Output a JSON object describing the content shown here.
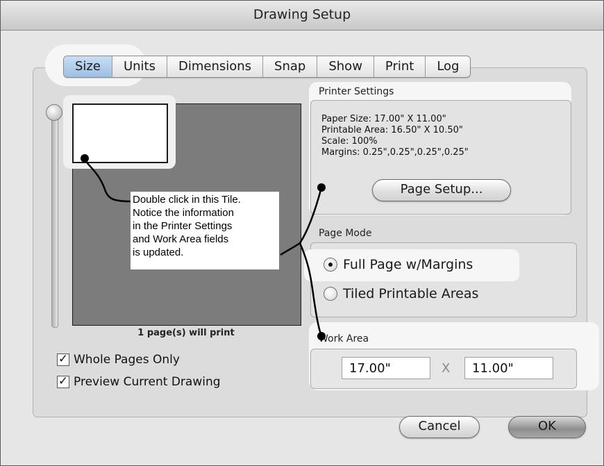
{
  "window": {
    "title": "Drawing Setup"
  },
  "tabs": [
    {
      "label": "Size",
      "active": true
    },
    {
      "label": "Units",
      "active": false
    },
    {
      "label": "Dimensions",
      "active": false
    },
    {
      "label": "Snap",
      "active": false
    },
    {
      "label": "Show",
      "active": false
    },
    {
      "label": "Print",
      "active": false
    },
    {
      "label": "Log",
      "active": false
    }
  ],
  "preview": {
    "pages_label": "1 page(s) will print"
  },
  "options": {
    "whole_pages_only": {
      "label": "Whole Pages Only",
      "checked": true
    },
    "preview_current": {
      "label": "Preview Current Drawing",
      "checked": true
    }
  },
  "printer_settings": {
    "title": "Printer Settings",
    "paper_size": "Paper Size: 17.00\" X 11.00\"",
    "printable_area": "Printable Area: 16.50\" X 10.50\"",
    "scale": "Scale: 100%",
    "margins": "Margins: 0.25\",0.25\",0.25\",0.25\"",
    "page_setup_label": "Page Setup..."
  },
  "page_mode": {
    "title": "Page Mode",
    "full_page": {
      "label": "Full Page w/Margins",
      "selected": true
    },
    "tiled": {
      "label": "Tiled Printable Areas",
      "selected": false
    }
  },
  "work_area": {
    "title": "Work Area",
    "width": "17.00\"",
    "separator": "X",
    "height": "11.00\""
  },
  "buttons": {
    "cancel": "Cancel",
    "ok": "OK"
  },
  "callout": {
    "lines": [
      "Double click in this Tile.",
      "Notice the information",
      "in the Printer Settings",
      "and Work Area fields",
      "is updated."
    ]
  }
}
